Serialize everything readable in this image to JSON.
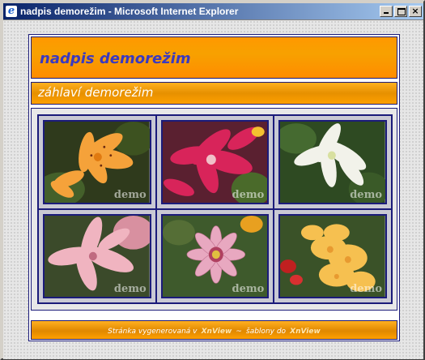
{
  "window": {
    "title": "nadpis demorežim - Microsoft Internet Explorer",
    "controls": {
      "minimize": "_",
      "maximize": "□",
      "close": "×"
    }
  },
  "page": {
    "heading": "nadpis demorežim",
    "subheading": "záhlaví demorežim",
    "gallery": [
      {
        "name": "orange-lily",
        "watermark": "demo"
      },
      {
        "name": "red-lily",
        "watermark": "demo"
      },
      {
        "name": "white-lily",
        "watermark": "demo"
      },
      {
        "name": "pink-lily",
        "watermark": "demo"
      },
      {
        "name": "gazania",
        "watermark": "demo"
      },
      {
        "name": "yellow-gladiolus",
        "watermark": "demo"
      }
    ],
    "footer": {
      "prefix": "Stránka vygenerovaná v",
      "link1": "XnView",
      "sep": "~",
      "text2": "šablony do",
      "link2": "XnView"
    }
  },
  "colors": {
    "accent": "#ff9800",
    "border": "#1b1b7a",
    "heading": "#3a3ac0"
  }
}
